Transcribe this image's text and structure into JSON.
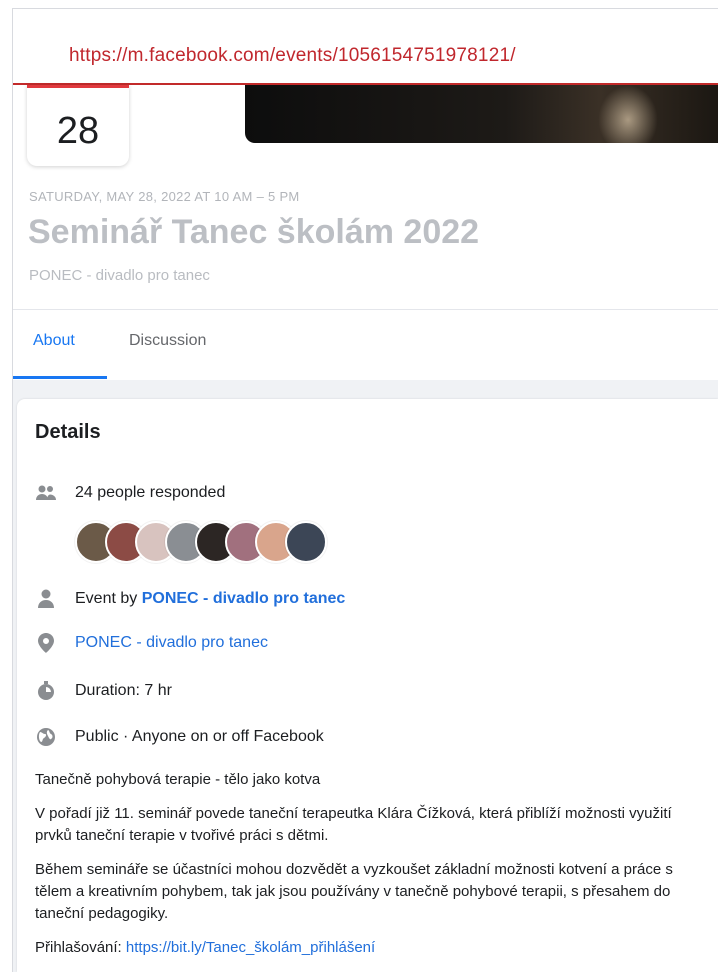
{
  "browser": {
    "url": "https://m.facebook.com/events/1056154751978121/"
  },
  "event": {
    "day": "28",
    "date_line": "SATURDAY, MAY 28, 2022 AT 10 AM – 5 PM",
    "title": "Seminář Tanec školám 2022",
    "organizer": "PONEC - divadlo pro tanec"
  },
  "tabs": [
    {
      "label": "About",
      "active": true
    },
    {
      "label": "Discussion",
      "active": false
    }
  ],
  "details": {
    "heading": "Details",
    "responded": "24 people responded",
    "avatar_colors": [
      "#6b5a48",
      "#8c4b45",
      "#d8c3bf",
      "#8a8e93",
      "#2c2624",
      "#a1707e",
      "#d9a58c",
      "#3c4656"
    ],
    "event_by_prefix": "Event by ",
    "event_by_name": "PONEC - divadlo pro tanec",
    "location": "PONEC - divadlo pro tanec",
    "duration": "Duration: 7 hr",
    "privacy": "Public · Anyone on or off Facebook",
    "description": [
      "Tanečně pohybová terapie - tělo jako kotva",
      "V pořadí již 11. seminář povede taneční terapeutka Klára Čížková, která přiblíží možnosti využití prvků taneční terapie v tvořivé práci s dětmi.",
      "Během semináře se účastníci mohou dozvědět a vyzkoušet základní možnosti kotvení a práce s tělem a kreativním pohybem, tak jak jsou používány v tanečně pohybové terapii, s přesahem do taneční pedagogiky."
    ],
    "registration_label": "Přihlašování: ",
    "registration_link": "https://bit.ly/Tanec_školám_přihlášení"
  },
  "icons": {
    "people": "people-icon",
    "person": "person-icon",
    "location": "location-pin-icon",
    "duration": "stopwatch-icon",
    "privacy": "globe-icon"
  },
  "colors": {
    "accent": "#1877f2",
    "url": "#c0272d",
    "date_card_top": "#e0393e"
  }
}
